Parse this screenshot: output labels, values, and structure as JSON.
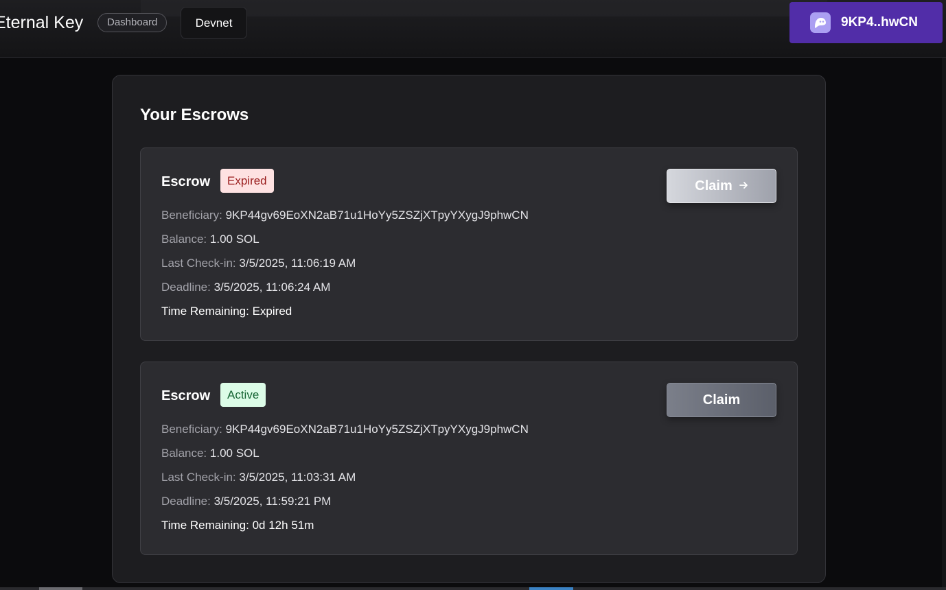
{
  "header": {
    "brand": "Eternal Key",
    "nav_pill": "Dashboard",
    "network_label": "Devnet",
    "wallet_label": "9KP4..hwCN",
    "wallet_icon": "ghost-icon"
  },
  "main": {
    "title": "Your Escrows",
    "escrows": [
      {
        "title": "Escrow",
        "status": "Expired",
        "claim_label": "Claim",
        "claim_icon": "arrow-right-icon",
        "beneficiary_label": "Beneficiary:",
        "beneficiary": "9KP44gv69EoXN2aB71u1HoYy5ZSZjXTpyYXygJ9phwCN",
        "balance_label": "Balance:",
        "balance": "1.00 SOL",
        "last_checkin_label": "Last Check-in:",
        "last_checkin": "3/5/2025, 11:06:19 AM",
        "deadline_label": "Deadline:",
        "deadline": "3/5/2025, 11:06:24 AM",
        "time_remaining_label": "Time Remaining:",
        "time_remaining": "Expired"
      },
      {
        "title": "Escrow",
        "status": "Active",
        "claim_label": "Claim",
        "beneficiary_label": "Beneficiary:",
        "beneficiary": "9KP44gv69EoXN2aB71u1HoYy5ZSZjXTpyYXygJ9phwCN",
        "balance_label": "Balance:",
        "balance": "1.00 SOL",
        "last_checkin_label": "Last Check-in:",
        "last_checkin": "3/5/2025, 11:03:31 AM",
        "deadline_label": "Deadline:",
        "deadline": "3/5/2025, 11:59:21 PM",
        "time_remaining_label": "Time Remaining:",
        "time_remaining": "0d 12h 51m"
      }
    ]
  },
  "colors": {
    "background": "#0b0b0d",
    "wallet_button": "#512da8",
    "expired_badge_bg": "#fee2e2",
    "expired_badge_text": "#991b1b",
    "active_badge_bg": "#dcfce7",
    "active_badge_text": "#166534"
  }
}
